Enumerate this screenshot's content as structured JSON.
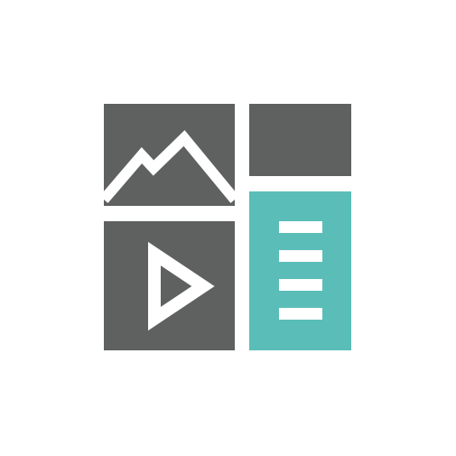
{
  "logo": {
    "name": "media-content-grid-logo",
    "colors": {
      "background": "#ffffff",
      "tile_dark": "#5f6060",
      "tile_accent": "#5bbdb8",
      "glyph": "#ffffff"
    },
    "tiles": [
      {
        "name": "image-tile",
        "icon": "mountain-icon"
      },
      {
        "name": "blank-tile",
        "icon": ""
      },
      {
        "name": "video-tile",
        "icon": "play-icon"
      },
      {
        "name": "document-tile",
        "icon": "list-lines-icon"
      }
    ]
  }
}
